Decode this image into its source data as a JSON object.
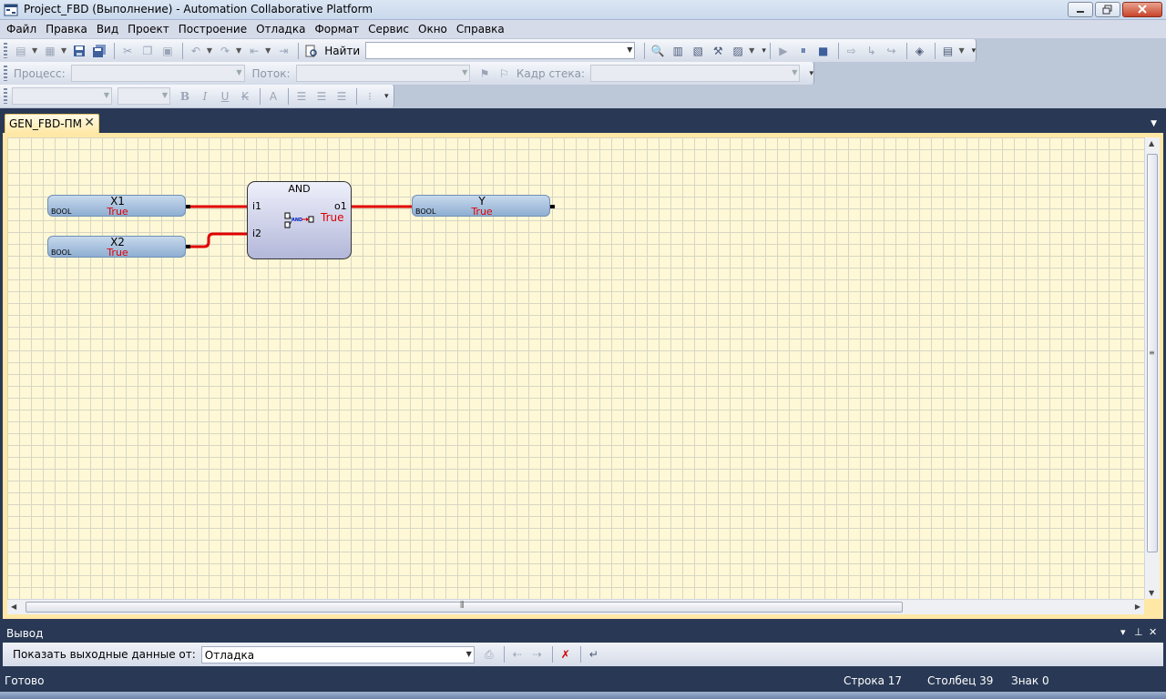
{
  "window": {
    "title": "Project_FBD (Выполнение) - Automation Collaborative Platform"
  },
  "menu": [
    "Файл",
    "Правка",
    "Вид",
    "Проект",
    "Построение",
    "Отладка",
    "Формат",
    "Сервис",
    "Окно",
    "Справка"
  ],
  "toolbar": {
    "find_label": "Найти",
    "find_value": "",
    "process_label": "Процесс:",
    "thread_label": "Поток:",
    "stack_label": "Кадр стека:"
  },
  "format_toolbar": {
    "bold": "B",
    "italic": "I",
    "underline": "U",
    "strike": "K"
  },
  "doc_tab": {
    "label": "GEN_FBD-ПМ"
  },
  "diagram": {
    "inputs": [
      {
        "name": "X1",
        "type": "BOOL",
        "value": "True"
      },
      {
        "name": "X2",
        "type": "BOOL",
        "value": "True"
      }
    ],
    "function_block": {
      "name": "AND",
      "inputs": [
        "i1",
        "i2"
      ],
      "output": "o1",
      "value": "True",
      "glyph_text": "AND"
    },
    "output": {
      "name": "Y",
      "type": "BOOL",
      "value": "True"
    }
  },
  "output_panel": {
    "title": "Вывод",
    "show_from_label": "Показать выходные данные от:",
    "show_from_value": "Отладка"
  },
  "status": {
    "ready": "Готово",
    "line": "Строка 17",
    "column": "Столбец 39",
    "char": "Знак 0"
  },
  "colors": {
    "canvas": "#fef8d6",
    "wire": "#e00000",
    "value_text": "#e00000",
    "frame_dark": "#293955"
  }
}
